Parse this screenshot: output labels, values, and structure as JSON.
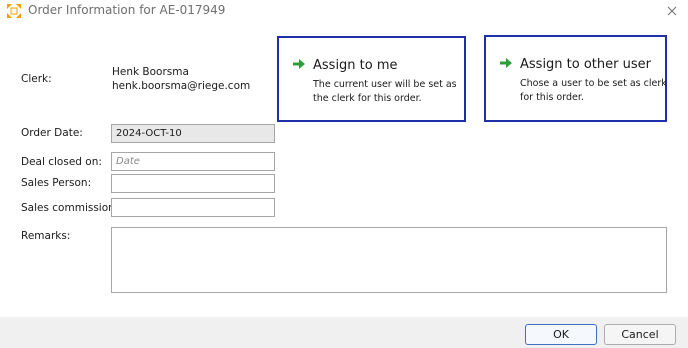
{
  "window": {
    "title": "Order Information for AE-017949"
  },
  "clerk": {
    "label": "Clerk:",
    "name": "Henk Boorsma",
    "email": "henk.boorsma@riege.com"
  },
  "assign_me": {
    "title": "Assign to me",
    "description": "The current user will be set as the clerk for this order."
  },
  "assign_other": {
    "title": "Assign to other user",
    "description": "Chose a user to be set as clerk for this order."
  },
  "form": {
    "order_date_label": "Order Date:",
    "order_date_value": "2024-OCT-10",
    "deal_closed_label": "Deal closed on:",
    "deal_closed_placeholder": "Date",
    "sales_person_label": "Sales Person:",
    "sales_person_value": "",
    "sales_commission_label": "Sales commission:",
    "sales_commission_value": "",
    "remarks_label": "Remarks:",
    "remarks_value": ""
  },
  "footer": {
    "ok_label": "OK",
    "cancel_label": "Cancel"
  },
  "colors": {
    "card_border": "#1f2fa8",
    "arrow_green": "#2e9e3a",
    "icon_orange": "#f5a000"
  },
  "icons": {
    "app": "app-logo-icon",
    "close": "close-icon",
    "arrow": "arrow-right-icon"
  }
}
